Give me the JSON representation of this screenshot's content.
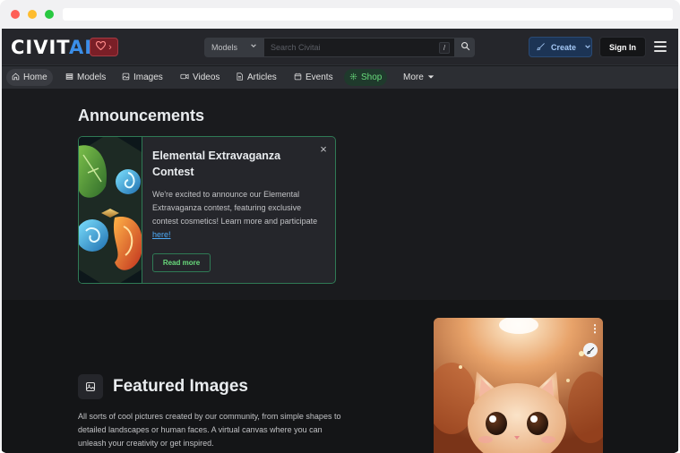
{
  "header": {
    "logo_main": "CIVIT",
    "logo_accent": "AI",
    "support_chevron": "›",
    "search_type": "Models",
    "search_placeholder": "Search Civitai",
    "search_shortcut": "/",
    "create_label": "Create",
    "signin_label": "Sign In"
  },
  "nav": {
    "items": [
      {
        "label": "Home",
        "icon": "home-icon"
      },
      {
        "label": "Models",
        "icon": "models-icon"
      },
      {
        "label": "Images",
        "icon": "image-icon"
      },
      {
        "label": "Videos",
        "icon": "video-icon"
      },
      {
        "label": "Articles",
        "icon": "article-icon"
      },
      {
        "label": "Events",
        "icon": "calendar-icon"
      },
      {
        "label": "Shop",
        "icon": "shop-icon"
      },
      {
        "label": "More",
        "icon": "chevron-down-icon"
      }
    ]
  },
  "announcements": {
    "title": "Announcements",
    "card": {
      "title": "Elemental Extravaganza Contest",
      "body": "We're excited to announce our Elemental Extravaganza contest, featuring exclusive contest cosmetics! Learn more and participate",
      "link_text": "here!",
      "button_label": "Read more",
      "close_label": "×"
    }
  },
  "featured": {
    "title": "Featured Images",
    "description": "All sorts of cool pictures created by our community, from simple shapes to detailed landscapes or human faces. A virtual canvas where you can unleash your creativity or get inspired."
  },
  "colors": {
    "accent_blue": "#3b8ee8",
    "shop_green": "#69db7c",
    "card_border": "#2f7a55",
    "background": "#1a1b1e"
  }
}
